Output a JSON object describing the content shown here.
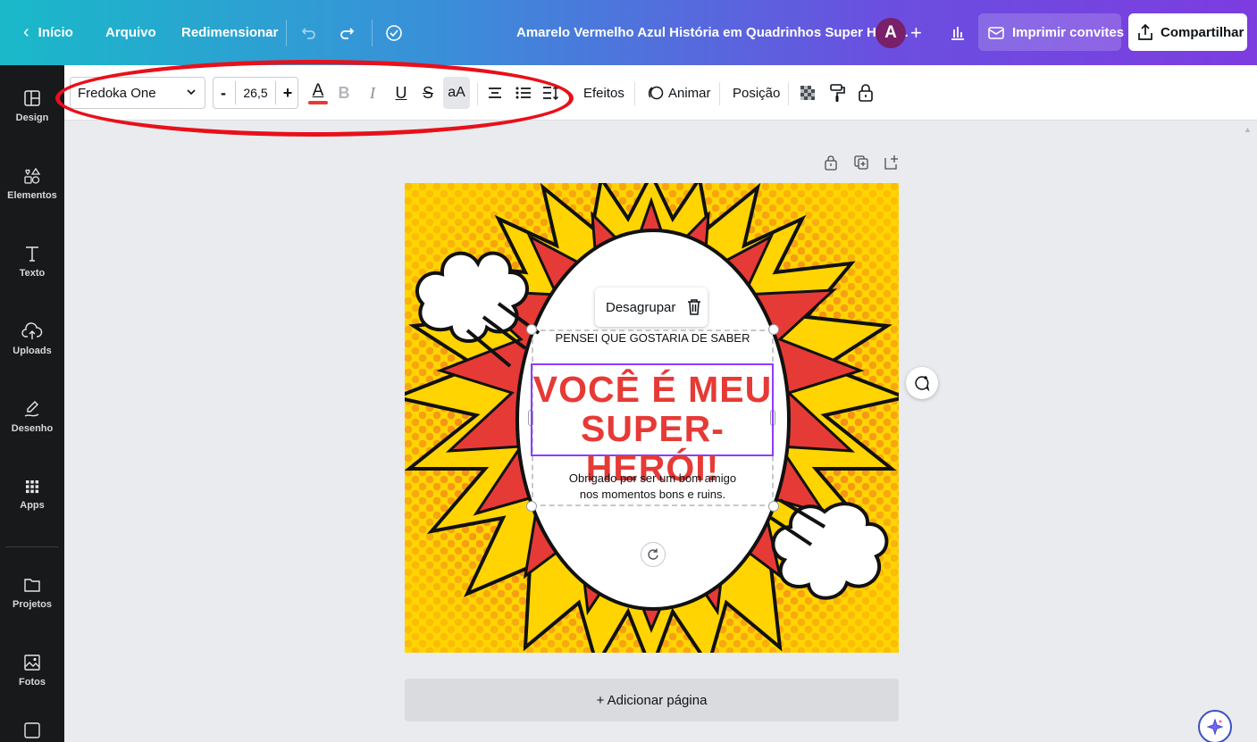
{
  "topbar": {
    "back_label": "Início",
    "menu": [
      "Arquivo",
      "Redimensionar"
    ],
    "document_title": "Amarelo Vermelho Azul História em Quadrinhos Super Heró...",
    "avatar_initial": "A",
    "print_label": "Imprimir convites",
    "share_label": "Compartilhar"
  },
  "sidebar": {
    "items": [
      {
        "label": "Design",
        "icon": "design-icon"
      },
      {
        "label": "Elementos",
        "icon": "elements-icon"
      },
      {
        "label": "Texto",
        "icon": "text-icon"
      },
      {
        "label": "Uploads",
        "icon": "upload-icon"
      },
      {
        "label": "Desenho",
        "icon": "draw-icon"
      },
      {
        "label": "Apps",
        "icon": "apps-icon"
      },
      {
        "label": "Projetos",
        "icon": "folder-icon"
      },
      {
        "label": "Fotos",
        "icon": "photo-icon"
      }
    ]
  },
  "toolbar": {
    "font_family_value": "Fredoka One",
    "font_size_value": "26,5",
    "minus": "-",
    "plus": "+",
    "text_color_glyph": "A",
    "text_color": "#e63a36",
    "bold": "B",
    "italic": "I",
    "underline": "U",
    "strike": "S",
    "case": "aA",
    "effects_label": "Efeitos",
    "animate_label": "Animar",
    "position_label": "Posição"
  },
  "canvas": {
    "floater_label": "Desagrupar",
    "line_top": "PENSEI QUE GOSTARIA DE SABER",
    "headline_line1": "VOCÊ É MEU",
    "headline_line2": "SUPER-HERÓI!",
    "body_line1": "Obrigado por ser um bom amigo",
    "body_line2": "nos momentos bons e ruins.",
    "add_page_label": "+ Adicionar página"
  },
  "colors": {
    "accent": "#8b3dff",
    "headline_red": "#e63a36",
    "burst_yellow": "#ffd400",
    "annotation_red": "#e8101a"
  }
}
